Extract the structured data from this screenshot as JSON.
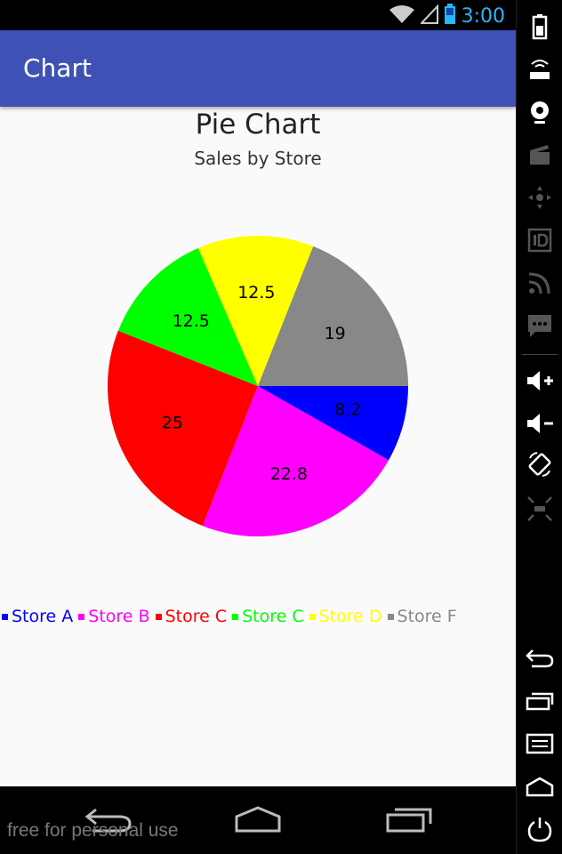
{
  "status_bar": {
    "time": "3:00"
  },
  "app_bar": {
    "title": "Chart"
  },
  "chart_data": {
    "type": "pie",
    "title": "Pie Chart",
    "subtitle": "Sales by Store",
    "slices": [
      {
        "label": "Store A",
        "value": 8.2,
        "color": "#0000ff"
      },
      {
        "label": "Store B",
        "value": 22.8,
        "color": "#ff00ff"
      },
      {
        "label": "Store C",
        "value": 25,
        "color": "#ff0000"
      },
      {
        "label": "Store C",
        "value": 12.5,
        "color": "#00ff00"
      },
      {
        "label": "Store D",
        "value": 12.5,
        "color": "#ffff00"
      },
      {
        "label": "Store F",
        "value": 19,
        "color": "#888888"
      }
    ],
    "legend_position": "bottom-left"
  },
  "watermark": "free for personal use",
  "colors": {
    "app_bar": "#3f51b5",
    "clock": "#29b6f6"
  }
}
